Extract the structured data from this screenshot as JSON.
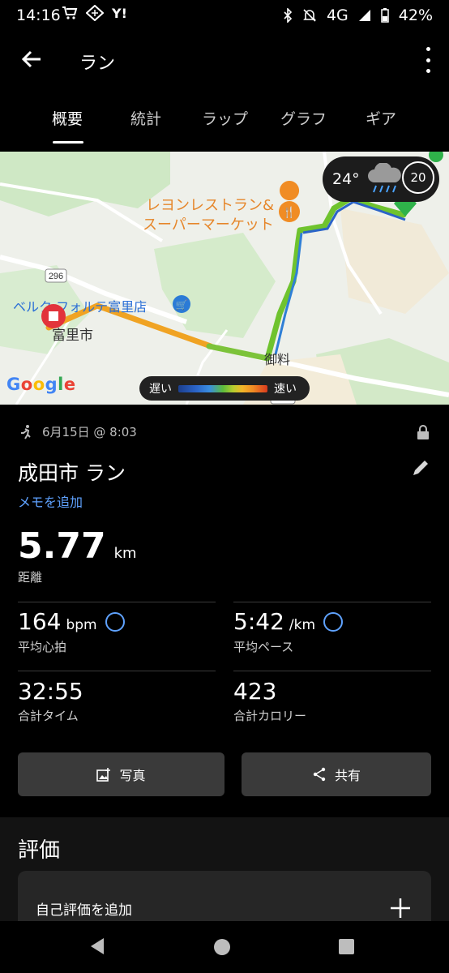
{
  "status_bar": {
    "time": "14:16",
    "network": "4G",
    "battery": "42%",
    "icons_left": [
      "cart-icon",
      "app-icon",
      "yahoo-icon"
    ],
    "icons_right": [
      "bluetooth-icon",
      "mute-icon",
      "signal-icon",
      "battery-icon"
    ]
  },
  "appbar": {
    "title": "ラン"
  },
  "tabs": [
    {
      "label": "概要",
      "active": true
    },
    {
      "label": "統計",
      "active": false
    },
    {
      "label": "ラップ",
      "active": false
    },
    {
      "label": "グラフ",
      "active": false
    },
    {
      "label": "ギア",
      "active": false
    }
  ],
  "map": {
    "labels": {
      "restaurant_line1": "レヨンレストラン&",
      "restaurant_line2": "スーパーマーケット",
      "store": "ベルク フォルテ富里店",
      "city": "富里市",
      "road_number": "296",
      "area": "御料",
      "road_small": "51"
    },
    "weather": {
      "temperature": "24°",
      "uv": "20"
    },
    "speed_legend": {
      "slow": "遅い",
      "fast": "速い"
    },
    "attribution": "Google"
  },
  "activity": {
    "date": "6月15日 @ 8:03",
    "title": "成田市 ラン",
    "add_memo": "メモを追加",
    "distance": {
      "value": "5.77",
      "unit": "km",
      "label": "距離"
    },
    "stats": [
      {
        "value": "164",
        "unit": "bpm",
        "label": "平均心拍"
      },
      {
        "value": "5:42",
        "unit": "/km",
        "label": "平均ペース"
      },
      {
        "value": "32:55",
        "unit": "",
        "label": "合計タイム"
      },
      {
        "value": "423",
        "unit": "",
        "label": "合計カロリー"
      }
    ],
    "buttons": {
      "photo": "写真",
      "share": "共有"
    }
  },
  "evaluation": {
    "title": "評価",
    "add_self_eval": "自己評価を追加"
  },
  "colors": {
    "accent_blue": "#5fa2ff",
    "route_green": "#6fc32e",
    "route_orange": "#f0a323",
    "route_blue": "#2f7fd6"
  }
}
